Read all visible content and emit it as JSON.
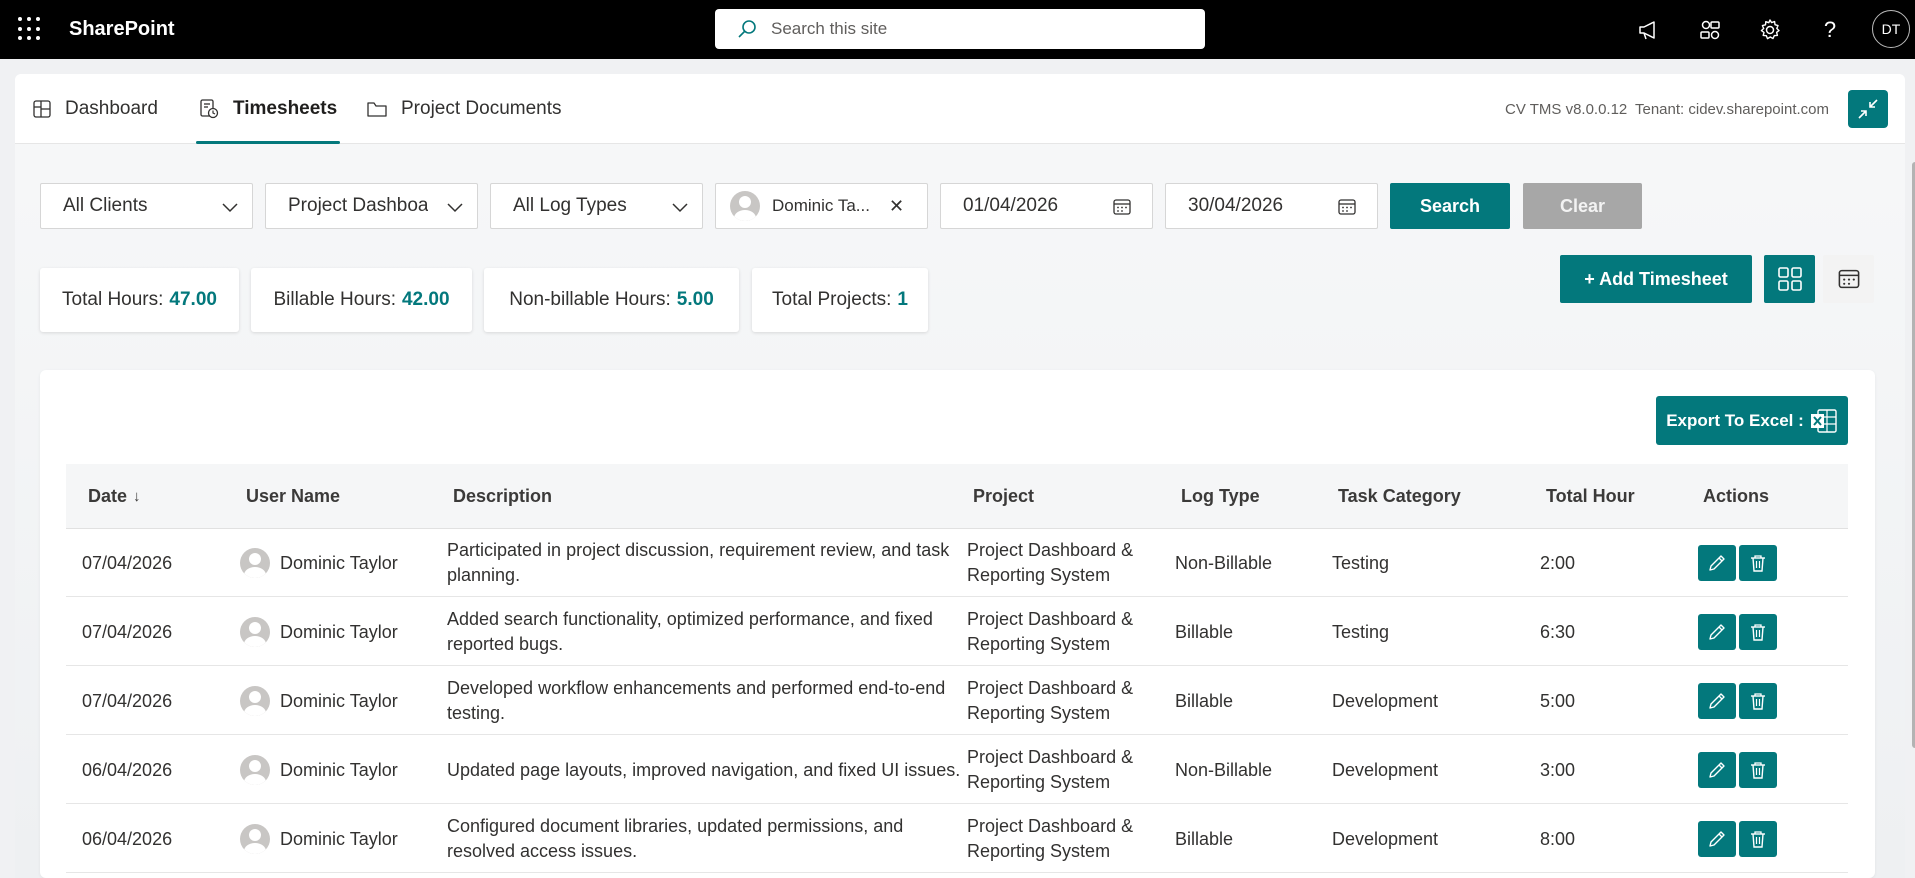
{
  "suitebar": {
    "brand": "SharePoint",
    "search_placeholder": "Search this site",
    "avatar_initials": "DT"
  },
  "tabs": [
    {
      "label": "Dashboard",
      "icon": "dashboard-icon"
    },
    {
      "label": "Timesheets",
      "icon": "timesheet-icon",
      "active": true
    },
    {
      "label": "Project Documents",
      "icon": "folder-icon"
    }
  ],
  "header": {
    "version": "CV TMS v8.0.0.12",
    "tenant": "Tenant: cidev.sharepoint.com"
  },
  "filters": {
    "client": "All Clients",
    "project": "Project Dashboard & Reporting System",
    "log_type": "All Log Types",
    "user": "Dominic Ta...",
    "from_date": "01/04/2026",
    "to_date": "30/04/2026",
    "search_label": "Search",
    "clear_label": "Clear"
  },
  "stats": {
    "total_hours_label": "Total Hours:",
    "total_hours": "47.00",
    "billable_label": "Billable Hours:",
    "billable": "42.00",
    "nonbillable_label": "Non-billable Hours:",
    "nonbillable": "5.00",
    "projects_label": "Total Projects:",
    "projects": "1"
  },
  "actions": {
    "add_timesheet": "+ Add Timesheet",
    "export": "Export To Excel :"
  },
  "table": {
    "columns": {
      "date": "Date",
      "user": "User Name",
      "description": "Description",
      "project": "Project",
      "log_type": "Log Type",
      "task_category": "Task Category",
      "total_hour": "Total Hour",
      "actions": "Actions"
    },
    "rows": [
      {
        "date": "07/04/2026",
        "user": "Dominic Taylor",
        "description": "Participated in project discussion, requirement review, and task planning.",
        "project": "Project Dashboard & Reporting System",
        "log_type": "Non-Billable",
        "task_category": "Testing",
        "total_hour": "2:00"
      },
      {
        "date": "07/04/2026",
        "user": "Dominic Taylor",
        "description": "Added search functionality, optimized performance, and fixed reported bugs.",
        "project": "Project Dashboard & Reporting System",
        "log_type": "Billable",
        "task_category": "Testing",
        "total_hour": "6:30"
      },
      {
        "date": "07/04/2026",
        "user": "Dominic Taylor",
        "description": "Developed workflow enhancements and performed end-to-end testing.",
        "project": "Project Dashboard & Reporting System",
        "log_type": "Billable",
        "task_category": "Development",
        "total_hour": "5:00"
      },
      {
        "date": "06/04/2026",
        "user": "Dominic Taylor",
        "description": "Updated page layouts, improved navigation, and fixed UI issues.",
        "project": "Project Dashboard & Reporting System",
        "log_type": "Non-Billable",
        "task_category": "Development",
        "total_hour": "3:00"
      },
      {
        "date": "06/04/2026",
        "user": "Dominic Taylor",
        "description": "Configured document libraries, updated permissions, and resolved access issues.",
        "project": "Project Dashboard & Reporting System",
        "log_type": "Billable",
        "task_category": "Development",
        "total_hour": "8:00"
      }
    ]
  },
  "colors": {
    "accent": "#03787c",
    "suitebar": "#000000",
    "disabled": "#a7a7a7"
  }
}
